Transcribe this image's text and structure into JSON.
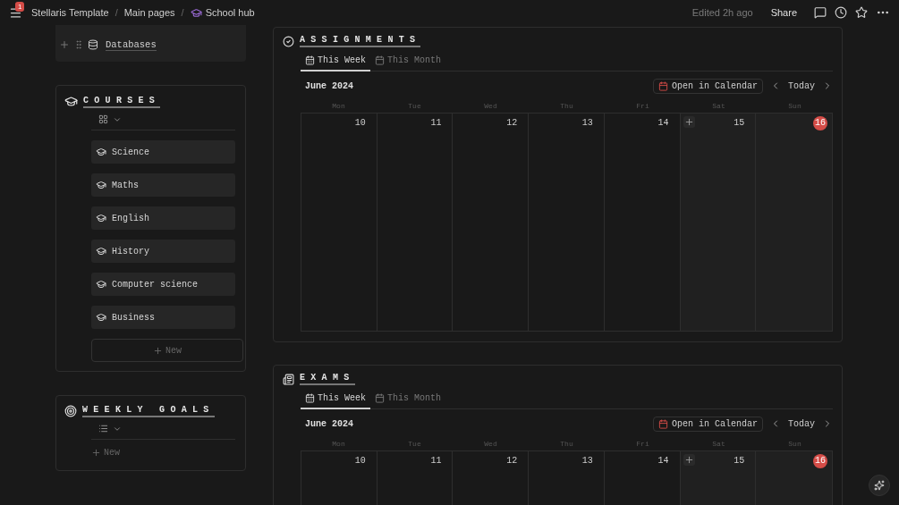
{
  "topbar": {
    "notification_count": "1",
    "separator": "/",
    "breadcrumbs": [
      {
        "label": "Stellaris Template"
      },
      {
        "label": "Main pages"
      },
      {
        "label": "School hub"
      }
    ],
    "edited": "Edited 2h ago",
    "share": "Share"
  },
  "links": [
    {
      "label": "Databases"
    }
  ],
  "courses": {
    "title": "COURSES",
    "items": [
      {
        "label": "Science"
      },
      {
        "label": "Maths"
      },
      {
        "label": "English"
      },
      {
        "label": "History"
      },
      {
        "label": "Computer science"
      },
      {
        "label": "Business"
      }
    ],
    "new": "New"
  },
  "weekly_goals": {
    "title": "WEEKLY GOALS",
    "new": "New"
  },
  "calendars": [
    {
      "title": "ASSIGNMENTS",
      "tabs": [
        {
          "label": "This Week",
          "selected": true
        },
        {
          "label": "This Month",
          "selected": false
        }
      ],
      "month": "June 2024",
      "open_button": "Open in Calendar",
      "today": "Today",
      "weekdays": [
        "Mon",
        "Tue",
        "Wed",
        "Thu",
        "Fri",
        "Sat",
        "Sun"
      ],
      "days": [
        {
          "label": "10",
          "weekend": false,
          "today": false,
          "hovered": false
        },
        {
          "label": "11",
          "weekend": false,
          "today": false,
          "hovered": false
        },
        {
          "label": "12",
          "weekend": false,
          "today": false,
          "hovered": false
        },
        {
          "label": "13",
          "weekend": false,
          "today": false,
          "hovered": false
        },
        {
          "label": "14",
          "weekend": false,
          "today": false,
          "hovered": false
        },
        {
          "label": "15",
          "weekend": true,
          "today": false,
          "hovered": true
        },
        {
          "label": "16",
          "weekend": true,
          "today": true,
          "hovered": false
        }
      ]
    },
    {
      "title": "EXAMS",
      "tabs": [
        {
          "label": "This Week",
          "selected": true
        },
        {
          "label": "This Month",
          "selected": false
        }
      ],
      "month": "June 2024",
      "open_button": "Open in Calendar",
      "today": "Today",
      "weekdays": [
        "Mon",
        "Tue",
        "Wed",
        "Thu",
        "Fri",
        "Sat",
        "Sun"
      ],
      "days": [
        {
          "label": "10",
          "weekend": false,
          "today": false,
          "hovered": false
        },
        {
          "label": "11",
          "weekend": false,
          "today": false,
          "hovered": false
        },
        {
          "label": "12",
          "weekend": false,
          "today": false,
          "hovered": false
        },
        {
          "label": "13",
          "weekend": false,
          "today": false,
          "hovered": false
        },
        {
          "label": "14",
          "weekend": false,
          "today": false,
          "hovered": false
        },
        {
          "label": "15",
          "weekend": true,
          "today": false,
          "hovered": true
        },
        {
          "label": "16",
          "weekend": true,
          "today": true,
          "hovered": false
        }
      ]
    }
  ]
}
